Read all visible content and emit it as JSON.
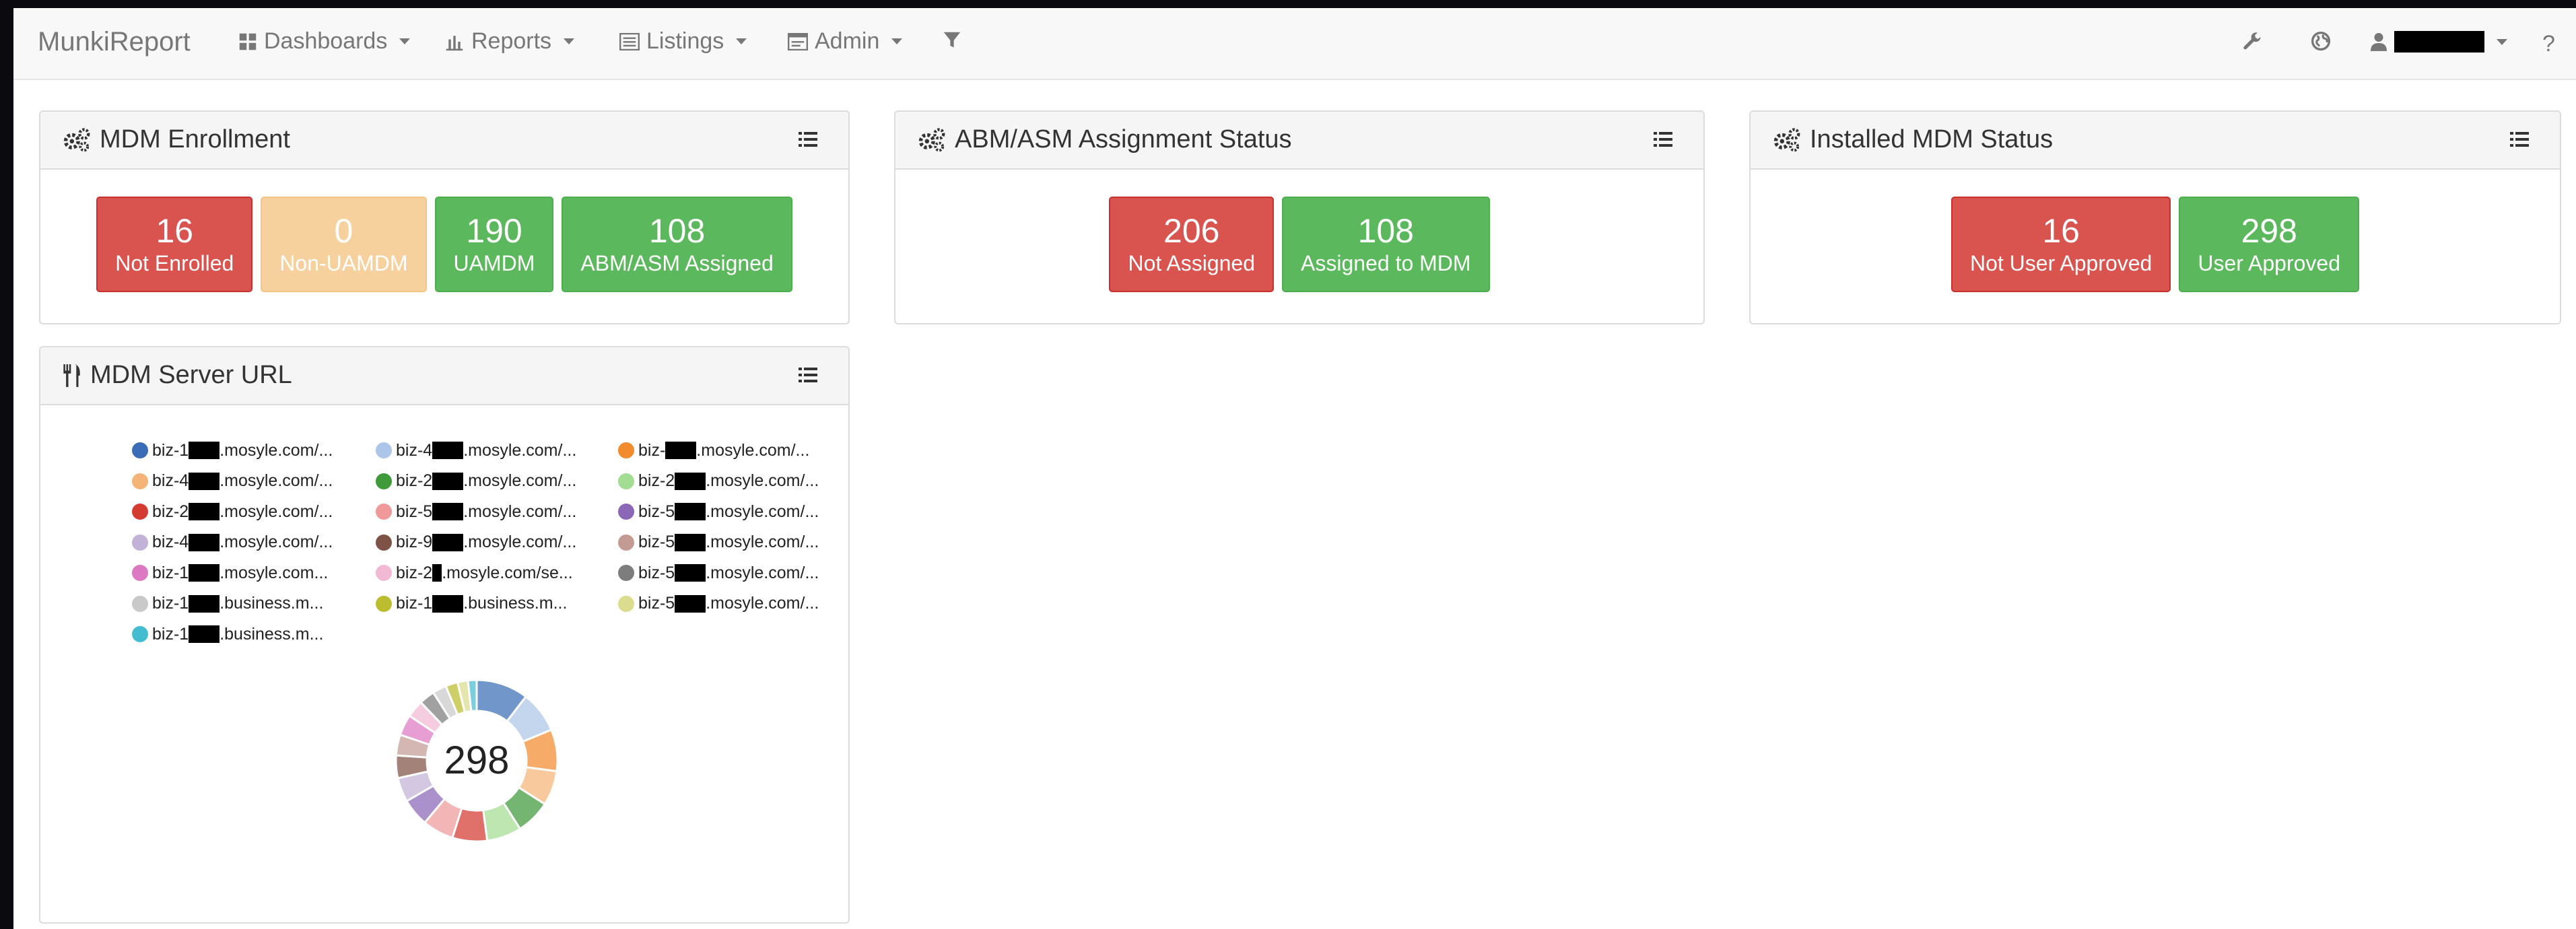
{
  "navbar": {
    "brand": "MunkiReport",
    "menus": [
      {
        "label": "Dashboards",
        "icon": "grid-icon"
      },
      {
        "label": "Reports",
        "icon": "bar-chart-icon"
      },
      {
        "label": "Listings",
        "icon": "list-icon"
      },
      {
        "label": "Admin",
        "icon": "admin-icon"
      }
    ],
    "filter_icon": "filter-icon",
    "settings_icon": "wrench-icon",
    "language_icon": "globe-icon",
    "user_icon": "user-icon",
    "help_label": "?"
  },
  "panels": {
    "mdm_enrollment": {
      "title": "MDM Enrollment",
      "tiles": [
        {
          "count": "16",
          "label": "Not Enrolled",
          "status": "danger"
        },
        {
          "count": "0",
          "label": "Non-UAMDM",
          "status": "warning"
        },
        {
          "count": "190",
          "label": "UAMDM",
          "status": "success"
        },
        {
          "count": "108",
          "label": "ABM/ASM Assigned",
          "status": "success"
        }
      ]
    },
    "abm_status": {
      "title": "ABM/ASM Assignment Status",
      "tiles": [
        {
          "count": "206",
          "label": "Not Assigned",
          "status": "danger"
        },
        {
          "count": "108",
          "label": "Assigned to MDM",
          "status": "success"
        }
      ]
    },
    "installed_status": {
      "title": "Installed MDM Status",
      "tiles": [
        {
          "count": "16",
          "label": "Not User Approved",
          "status": "danger"
        },
        {
          "count": "298",
          "label": "User Approved",
          "status": "success"
        }
      ]
    },
    "server_url": {
      "title": "MDM Server URL",
      "total": "298"
    }
  },
  "chart_data": {
    "type": "pie",
    "center_label": "298",
    "legend": [
      {
        "prefix": "biz-1",
        "suffix": ".mosyle.com/...",
        "color": "#3a6db5"
      },
      {
        "prefix": "biz-4",
        "suffix": ".mosyle.com/...",
        "color": "#adc5e8"
      },
      {
        "prefix": "biz-",
        "suffix": ".mosyle.com/...",
        "color": "#f28a2e"
      },
      {
        "prefix": "biz-4",
        "suffix": ".mosyle.com/...",
        "color": "#f5b477"
      },
      {
        "prefix": "biz-2",
        "suffix": ".mosyle.com/...",
        "color": "#3f9a3a"
      },
      {
        "prefix": "biz-2",
        "suffix": ".mosyle.com/...",
        "color": "#a3dc93"
      },
      {
        "prefix": "biz-2",
        "suffix": ".mosyle.com/...",
        "color": "#d33a30"
      },
      {
        "prefix": "biz-5",
        "suffix": ".mosyle.com/...",
        "color": "#f0989a"
      },
      {
        "prefix": "biz-5",
        "suffix": ".mosyle.com/...",
        "color": "#8b67b8"
      },
      {
        "prefix": "biz-4",
        "suffix": ".mosyle.com/...",
        "color": "#c3b2d7"
      },
      {
        "prefix": "biz-9",
        "suffix": ".mosyle.com/...",
        "color": "#7f5247"
      },
      {
        "prefix": "biz-5",
        "suffix": ".mosyle.com/...",
        "color": "#c49b94"
      },
      {
        "prefix": "biz-1",
        "suffix": ".mosyle.com...",
        "color": "#dd78c2"
      },
      {
        "prefix": "biz-2",
        "suffix": ".mosyle.com/se...",
        "color": "#f2b9d4"
      },
      {
        "prefix": "biz-5",
        "suffix": ".mosyle.com/...",
        "color": "#7d7d7d"
      },
      {
        "prefix": "biz-1",
        "suffix": ".business.m...",
        "color": "#c9c9c9"
      },
      {
        "prefix": "biz-1",
        "suffix": ".business.m...",
        "color": "#bcbd2e"
      },
      {
        "prefix": "biz-5",
        "suffix": ".mosyle.com/...",
        "color": "#dbdc8e"
      },
      {
        "prefix": "biz-1",
        "suffix": ".business.m...",
        "color": "#45bdd0"
      }
    ],
    "values": [
      30,
      24,
      24,
      20,
      20,
      20,
      20,
      18,
      16,
      14,
      13,
      12,
      12,
      10,
      9,
      8,
      7,
      6,
      5
    ]
  }
}
